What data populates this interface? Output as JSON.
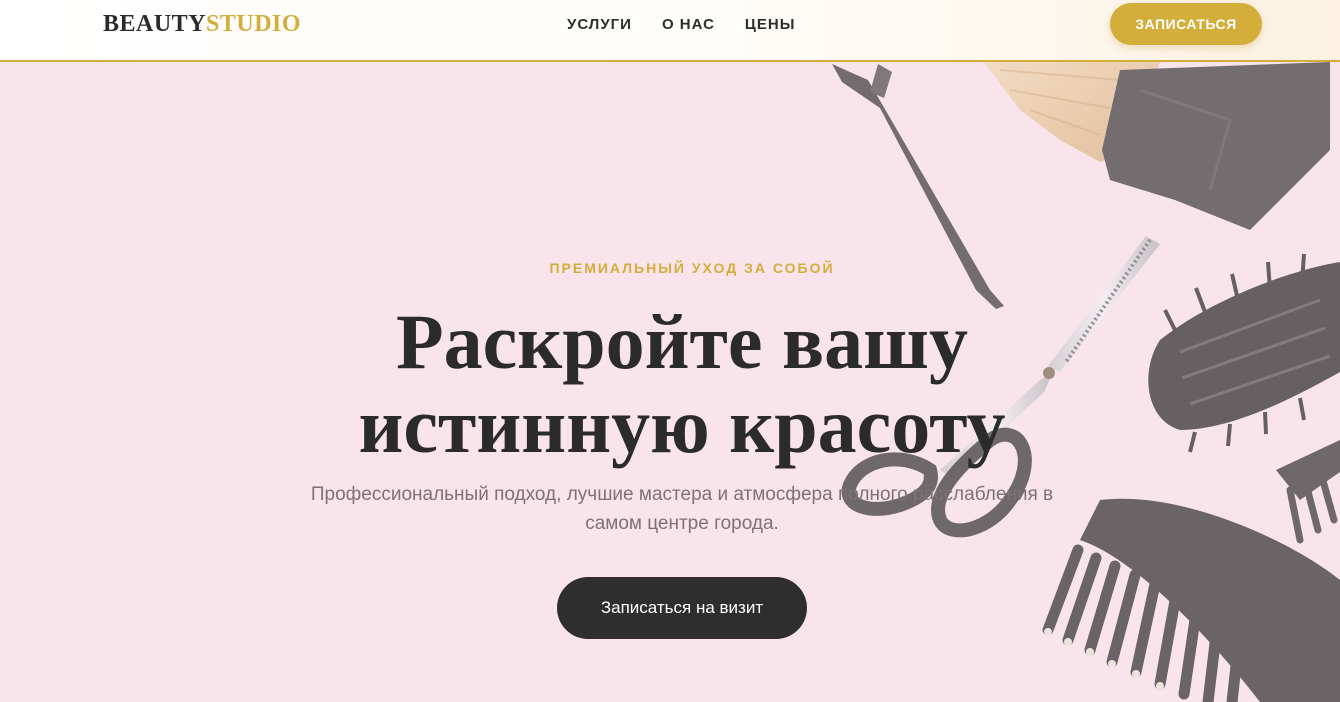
{
  "brand": {
    "part1": "BEAUTY",
    "part2": "STUDIO"
  },
  "nav": {
    "items": [
      "УСЛУГИ",
      "О НАС",
      "ЦЕНЫ"
    ]
  },
  "header": {
    "cta_label": "ЗАПИСАТЬСЯ"
  },
  "hero": {
    "eyebrow": "ПРЕМИАЛЬНЫЙ УХОД ЗА СОБОЙ",
    "title_line1": "Раскройте вашу",
    "title_line2": "истинную красоту",
    "subtitle_line1": "Профессиональный подход, лучшие мастера и атмосфера полного расслабления в",
    "subtitle_line2": "самом центре города.",
    "cta_label": "Записаться на визит"
  },
  "colors": {
    "accent": "#d4ae3a",
    "dark": "#2b2b2b",
    "background": "#f9e4ec",
    "button_dark": "#2e2e2e"
  },
  "background_image": {
    "icons": [
      "hair-clip-icon",
      "brush-icon",
      "thinning-scissors-icon",
      "round-brush-icon",
      "comb-icon"
    ]
  }
}
